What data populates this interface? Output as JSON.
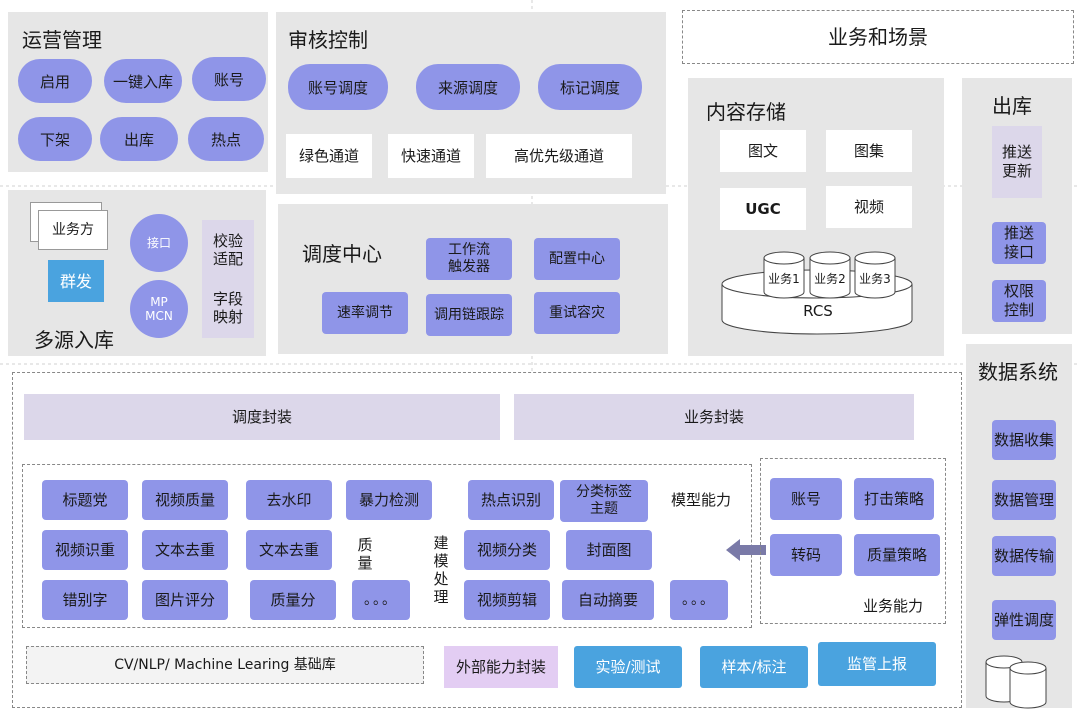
{
  "ops": {
    "title": "运营管理",
    "items": [
      "启用",
      "一键入库",
      "账号",
      "下架",
      "出库",
      "热点"
    ]
  },
  "review": {
    "title": "审核控制",
    "pills": [
      "账号调度",
      "来源调度",
      "标记调度"
    ],
    "channels": [
      "绿色通道",
      "快速通道",
      "高优先级通道"
    ]
  },
  "scene": {
    "title": "业务和场景"
  },
  "storage": {
    "title": "内容存储",
    "types": [
      "图文",
      "图集",
      "UGC",
      "视频"
    ],
    "dbs": [
      "业务1",
      "业务2",
      "业务3"
    ],
    "rcs": "RCS"
  },
  "outlib": {
    "title": "出库",
    "items": [
      "推送\n更新",
      "推送\n接口",
      "权限\n控制"
    ]
  },
  "intake": {
    "title": "多源入库",
    "business": "业务方",
    "group": "群发",
    "api": "接口",
    "mp": "MP\nMCN",
    "checks": [
      "校验\n适配",
      "字段\n映射"
    ]
  },
  "dispatch": {
    "title": "调度中心",
    "items": [
      "工作流\n触发器",
      "配置中心",
      "速率调节",
      "调用链跟踪",
      "重试容灾"
    ]
  },
  "datasys": {
    "title": "数据系统",
    "items": [
      "数据收集",
      "数据管理",
      "数据传输",
      "弹性调度"
    ]
  },
  "wrap": {
    "dispatch": "调度封装",
    "business": "业务封装"
  },
  "quality": {
    "items": [
      "标题党",
      "视频质量",
      "去水印",
      "暴力检测",
      "视频识重",
      "文本去重",
      "文本去重",
      "错别字",
      "图片评分",
      "质量分",
      "。。。"
    ],
    "label": "质\n量",
    "modeling": "建\n模\n处\n理"
  },
  "model": {
    "items": [
      "热点识别",
      "分类标签\n主题",
      "视频分类",
      "封面图",
      "视频剪辑",
      "自动摘要",
      "。。。"
    ],
    "label": "模型能力"
  },
  "biz": {
    "items": [
      "账号",
      "打击策略",
      "转码",
      "质量策略"
    ],
    "label": "业务能力"
  },
  "bottom": {
    "base": "CV/NLP/ Machine Learing 基础库",
    "external": "外部能力封装",
    "experiment": "实验/测试",
    "sample": "样本/标注",
    "monitor": "监管上报"
  }
}
